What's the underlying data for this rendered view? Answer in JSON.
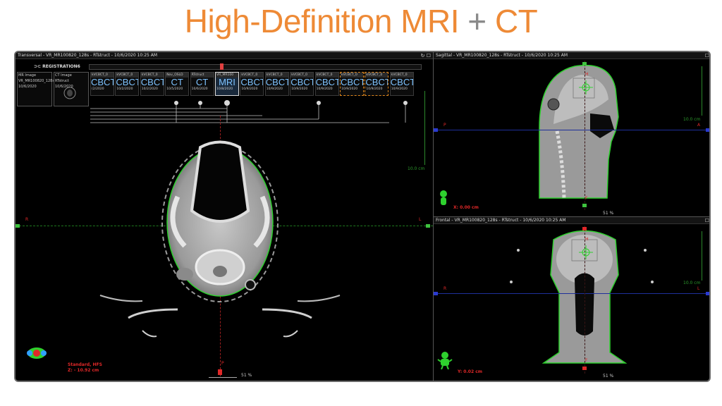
{
  "slide": {
    "title_part1": "High-Definition MRI",
    "title_plus": "+",
    "title_part2": "CT"
  },
  "colors": {
    "title_accent": "#ee8a36",
    "title_plus": "#8a8a8a",
    "contour": "#2ed12e",
    "marker_red": "#e02828",
    "tile_text": "#7ec3ff",
    "selected_border": "#e0881e"
  },
  "transversal": {
    "header": "Transversal - VR_MR100820_128s - RTstruct - 10/6/2020 10:25 AM",
    "controls": "↻ ☐",
    "registration_label": "⊃⊂ REGISTRATION6",
    "scale_label": "10.0 cm",
    "left_letter": "R",
    "right_letter": "L",
    "bottom_letter": "P",
    "standard_label": "Standard, HFS",
    "z_label": "Z: - 10.92 cm",
    "zoom": "51 %"
  },
  "thumbnails": [
    {
      "line1": "MR Image",
      "line2": "VR_MR100820_128s",
      "line3": "10/6/2020"
    },
    {
      "line1": "CT Image",
      "line2": "RTstruct",
      "line3": "10/6/2020"
    }
  ],
  "tiles": [
    {
      "head": "kVCBCT_0",
      "big": "CBCT",
      "date": "(2/2020"
    },
    {
      "head": "kVCBCT_0",
      "big": "CBCT",
      "date": "10/2/2020"
    },
    {
      "head": "kVCBCT_0",
      "big": "CBCT",
      "date": "10/2/2020"
    },
    {
      "head": "Nov_OSLD",
      "big": "CT",
      "date": "10/5/2020"
    },
    {
      "head": "RTstruct",
      "big": "CT",
      "date": "10/6/2020"
    },
    {
      "head": "VR_MR100",
      "big": "MRI",
      "date": "10/8/2020"
    },
    {
      "head": "kVCBCT_0",
      "big": "CBCT",
      "date": "10/9/2020"
    },
    {
      "head": "kVCBCT_0",
      "big": "CBCT",
      "date": "10/9/2020"
    },
    {
      "head": "kVCBCT_0",
      "big": "CBCT",
      "date": "10/9/2020"
    },
    {
      "head": "kVCBCT_0",
      "big": "CBCT",
      "date": "10/9/2020"
    },
    {
      "head": "kVCBCT_0",
      "big": "CBCT",
      "date": "10/9/2020"
    },
    {
      "head": "kVCBCT_0",
      "big": "CBCT",
      "date": "10/9/2020"
    },
    {
      "head": "kVCBCT_0",
      "big": "CBCT",
      "date": "10/9/2020"
    }
  ],
  "sagittal": {
    "header": "Sagittal - VR_MR100820_128s - RTstruct - 10/6/2020 10:25 AM",
    "controls": "☐",
    "scale_label": "10.0 cm",
    "left_letter": "P",
    "right_letter": "A",
    "top_letter": "H",
    "bottom_letter": "F",
    "x_label": "X: 0.00 cm",
    "zoom": "51 %"
  },
  "frontal": {
    "header": "Frontal - VR_MR100820_128s - RTstruct - 10/6/2020 10:25 AM",
    "controls": "☐",
    "scale_label": "10.0 cm",
    "left_letter": "R",
    "right_letter": "L",
    "top_letter": "H",
    "bottom_letter": "F",
    "y_label": "Y: 0.02 cm",
    "zoom": "51 %"
  }
}
